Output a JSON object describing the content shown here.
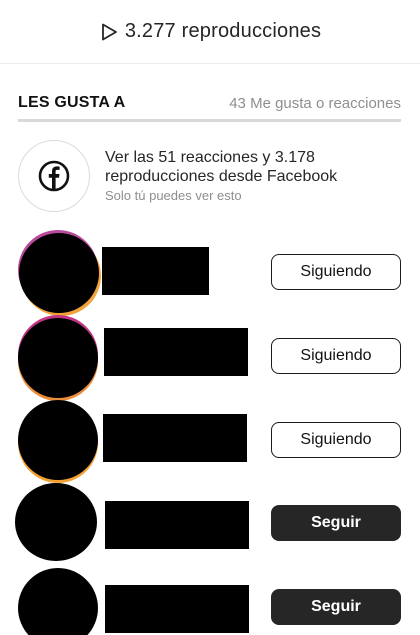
{
  "header": {
    "play_icon": "play-outline-icon",
    "views_text": "3.277 reproducciones"
  },
  "likes": {
    "title": "LES GUSTA A",
    "count_text": "43 Me gusta o reacciones"
  },
  "facebook": {
    "icon": "facebook-icon",
    "main_text": "Ver las 51 reacciones y 3.178 reproducciones desde Facebook",
    "sub_text": "Solo tú puedes ver esto"
  },
  "users": [
    {
      "button_label": "Siguiendo",
      "state": "following"
    },
    {
      "button_label": "Siguiendo",
      "state": "following"
    },
    {
      "button_label": "Siguiendo",
      "state": "following"
    },
    {
      "button_label": "Seguir",
      "state": "follow"
    },
    {
      "button_label": "Seguir",
      "state": "follow"
    }
  ],
  "colors": {
    "follow_button": "#262626",
    "story_ring_pink": "#c13584",
    "story_ring_orange": "#f2a23a",
    "muted_text": "#8e8e8e"
  }
}
